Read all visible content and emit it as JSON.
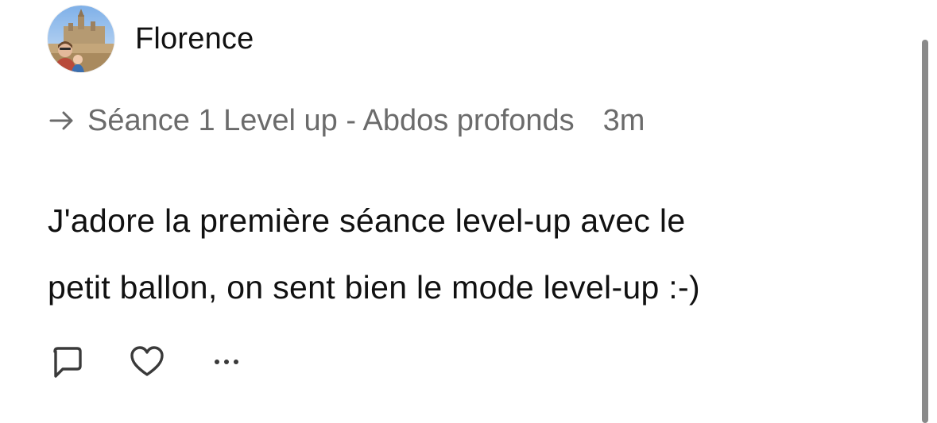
{
  "post": {
    "author": {
      "name": "Florence"
    },
    "context": {
      "title": "Séance 1 Level up - Abdos profonds",
      "timestamp": "3m"
    },
    "body": {
      "line1": "J'adore la première séance level-up avec le",
      "line2": "petit ballon, on sent bien le mode level-up :-)"
    },
    "actions": {
      "icons": [
        "comment-icon",
        "heart-icon",
        "ellipsis-icon"
      ]
    }
  },
  "colors": {
    "primary_text": "#111111",
    "secondary_text": "#6b6b6b",
    "icon_stroke": "#3a3a3a",
    "scrollbar": "#8a8a8a",
    "background": "#ffffff"
  }
}
